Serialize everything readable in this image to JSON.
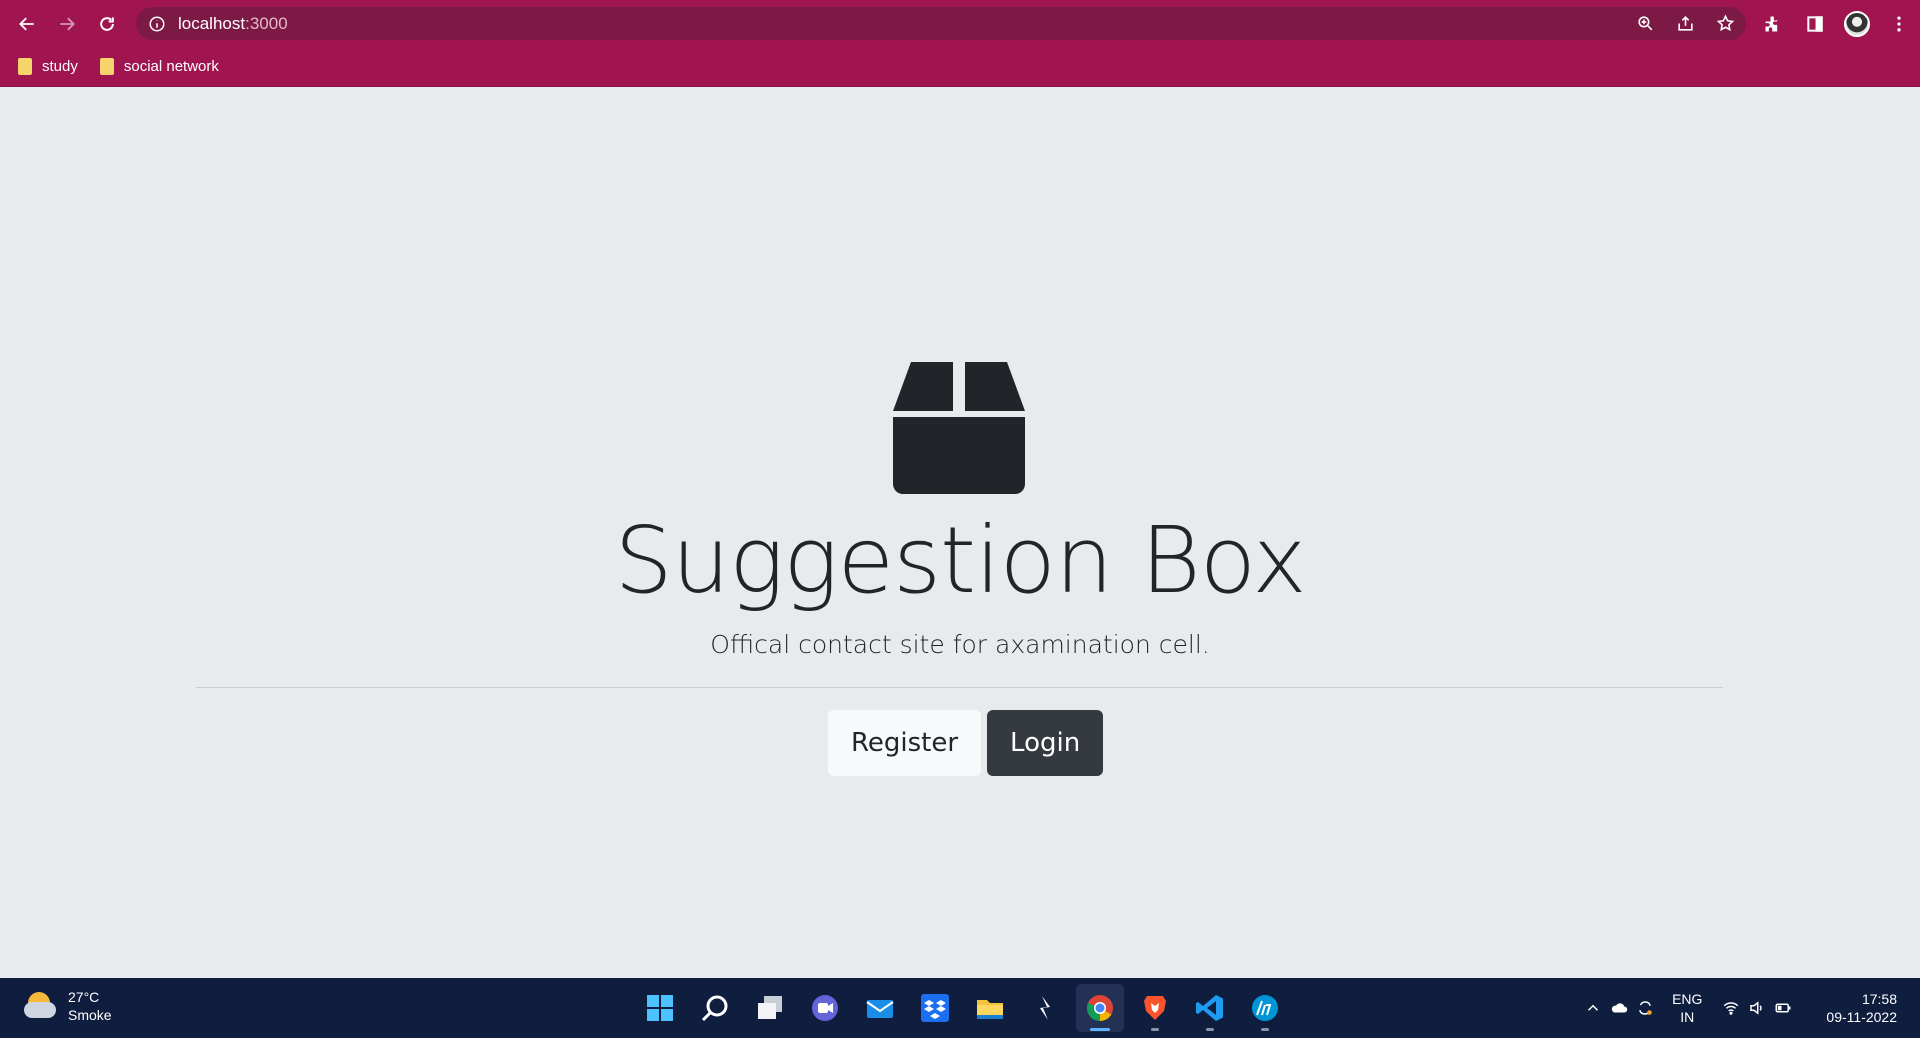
{
  "browser": {
    "url_host": "localhost",
    "url_port": ":3000",
    "bookmarks": [
      {
        "label": "study"
      },
      {
        "label": "social network"
      }
    ],
    "colors": {
      "frame": "#a0154f",
      "omnibox": "#7c1a45"
    }
  },
  "page": {
    "icon": "box-seam-icon",
    "title": "Suggestion Box",
    "subtitle": "Offical contact site for axamination cell.",
    "buttons": {
      "register": "Register",
      "login": "Login"
    }
  },
  "taskbar": {
    "weather": {
      "temp": "27°C",
      "condition": "Smoke"
    },
    "apps": [
      "start-icon",
      "search-icon",
      "task-view-icon",
      "teams-chat-icon",
      "mail-icon",
      "dropbox-icon",
      "file-explorer-icon",
      "cursor-app-icon",
      "chrome-icon",
      "brave-icon",
      "vscode-icon",
      "hp-icon"
    ],
    "lang": {
      "line1": "ENG",
      "line2": "IN"
    },
    "clock": {
      "time": "17:58",
      "date": "09-11-2022"
    }
  }
}
